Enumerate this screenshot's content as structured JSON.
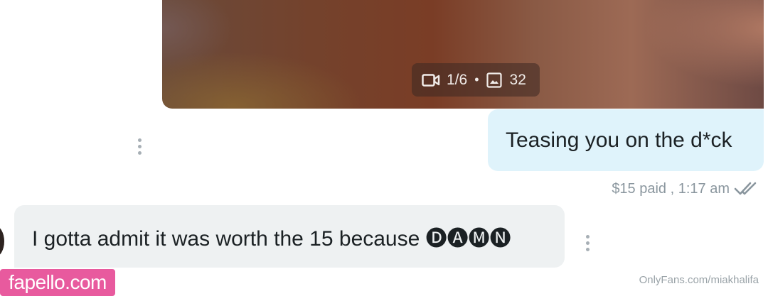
{
  "media": {
    "video_count": "1/6",
    "separator": "•",
    "photo_count": "32",
    "video_icon": "video-camera-icon",
    "photo_icon": "image-icon"
  },
  "messages": [
    {
      "direction": "sent",
      "text": "Teasing you on the d*ck",
      "meta": "$15 paid , 1:17 am",
      "status_icon": "double-check-icon"
    },
    {
      "direction": "received",
      "text": "I gotta admit it was worth the 15 because 🅓🅐🅜🅝"
    }
  ],
  "watermark": "fapello.com",
  "footer_url": "OnlyFans.com/miakhalifa",
  "colors": {
    "sent_bubble": "#dff3fb",
    "received_bubble": "#eef1f2",
    "meta_text": "#8a969e",
    "watermark_bg": "#e85a9e"
  }
}
